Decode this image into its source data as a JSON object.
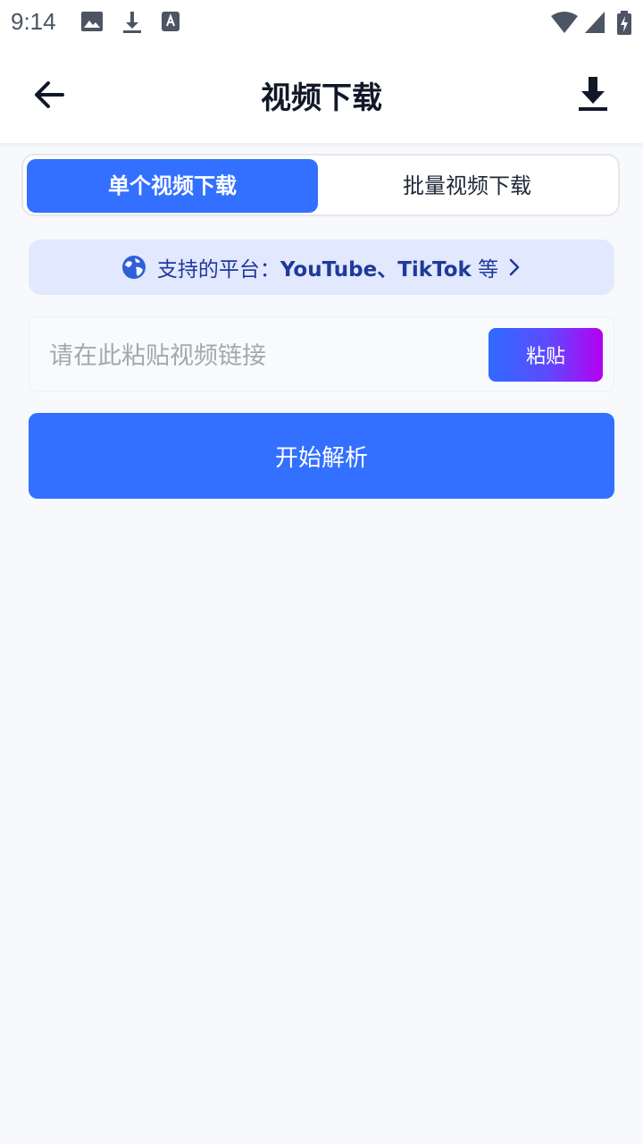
{
  "status_bar": {
    "time": "9:14",
    "icons": [
      "image-icon",
      "download-icon",
      "keyboard-a-icon",
      "wifi-icon",
      "signal-icon",
      "battery-charging-icon"
    ]
  },
  "app_bar": {
    "title": "视频下载",
    "back_icon": "arrow-left-icon",
    "action_icon": "download-icon"
  },
  "tabs": [
    {
      "label": "单个视频下载",
      "active": true
    },
    {
      "label": "批量视频下载",
      "active": false
    }
  ],
  "platform_banner": {
    "prefix": "支持的平台：",
    "platforms": "YouTube、TikTok",
    "suffix": " 等",
    "icon": "globe-icon",
    "chevron": "chevron-right-icon"
  },
  "url_input": {
    "placeholder": "请在此粘贴视频链接",
    "value": ""
  },
  "paste_button": "粘贴",
  "parse_button": "开始解析",
  "colors": {
    "primary": "#3370ff",
    "banner_bg": "#e2e8fd",
    "banner_text": "#1e3a9a",
    "page_bg": "#f7f9fc"
  }
}
